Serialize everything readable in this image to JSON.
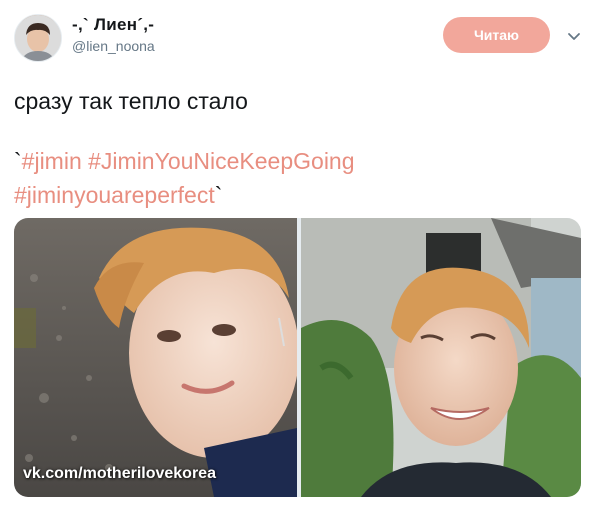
{
  "author": {
    "display_name": "-,` Лиен´,-",
    "handle": "@lien_noona"
  },
  "follow_button": {
    "label": "Читаю",
    "color": "#f2a79b"
  },
  "tweet": {
    "text": "сразу так тепло стало",
    "open_mark": "`",
    "hashtags": [
      "#jimin",
      "#JiminYouNiceKeepGoing",
      "#jiminyouareperfect"
    ],
    "close_mark": "`",
    "hashtag_color": "#e88e80"
  },
  "media": {
    "watermark": "vk.com/motherilovekorea",
    "photos": [
      "selfie-left",
      "selfie-right"
    ]
  },
  "icons": {
    "menu": "chevron-down-icon"
  }
}
